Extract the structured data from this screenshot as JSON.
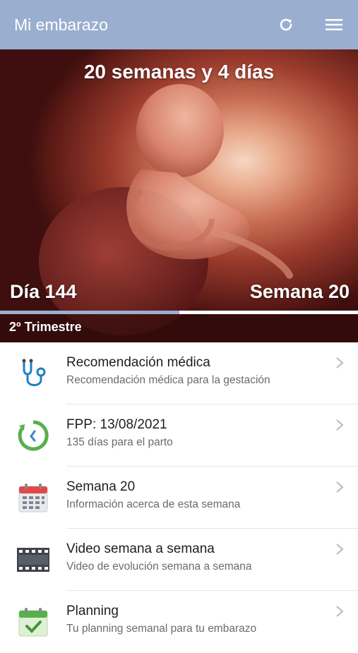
{
  "appbar": {
    "title": "Mi embarazo",
    "refresh_icon": "refresh-icon",
    "menu_icon": "hamburger-menu-icon",
    "color": "#9aaecf"
  },
  "hero": {
    "title": "20 semanas y 4 días",
    "day_label": "Día 144",
    "week_label": "Semana 20",
    "trimester": "2º Trimestre",
    "progress": 0.5
  },
  "items": [
    {
      "icon": "stethoscope-icon",
      "title": "Recomendación médica",
      "subtitle": "Recomendación médica para la gestación"
    },
    {
      "icon": "clock-countdown-icon",
      "title": "FPP: 13/08/2021",
      "subtitle": "135 días para el parto"
    },
    {
      "icon": "calendar-icon",
      "title": "Semana 20",
      "subtitle": "Información acerca de esta semana"
    },
    {
      "icon": "film-icon",
      "title": "Video semana a semana",
      "subtitle": "Video de evolución semana a semana"
    },
    {
      "icon": "calendar-check-icon",
      "title": "Planning",
      "subtitle": "Tu planning semanal para tu embarazo"
    }
  ]
}
